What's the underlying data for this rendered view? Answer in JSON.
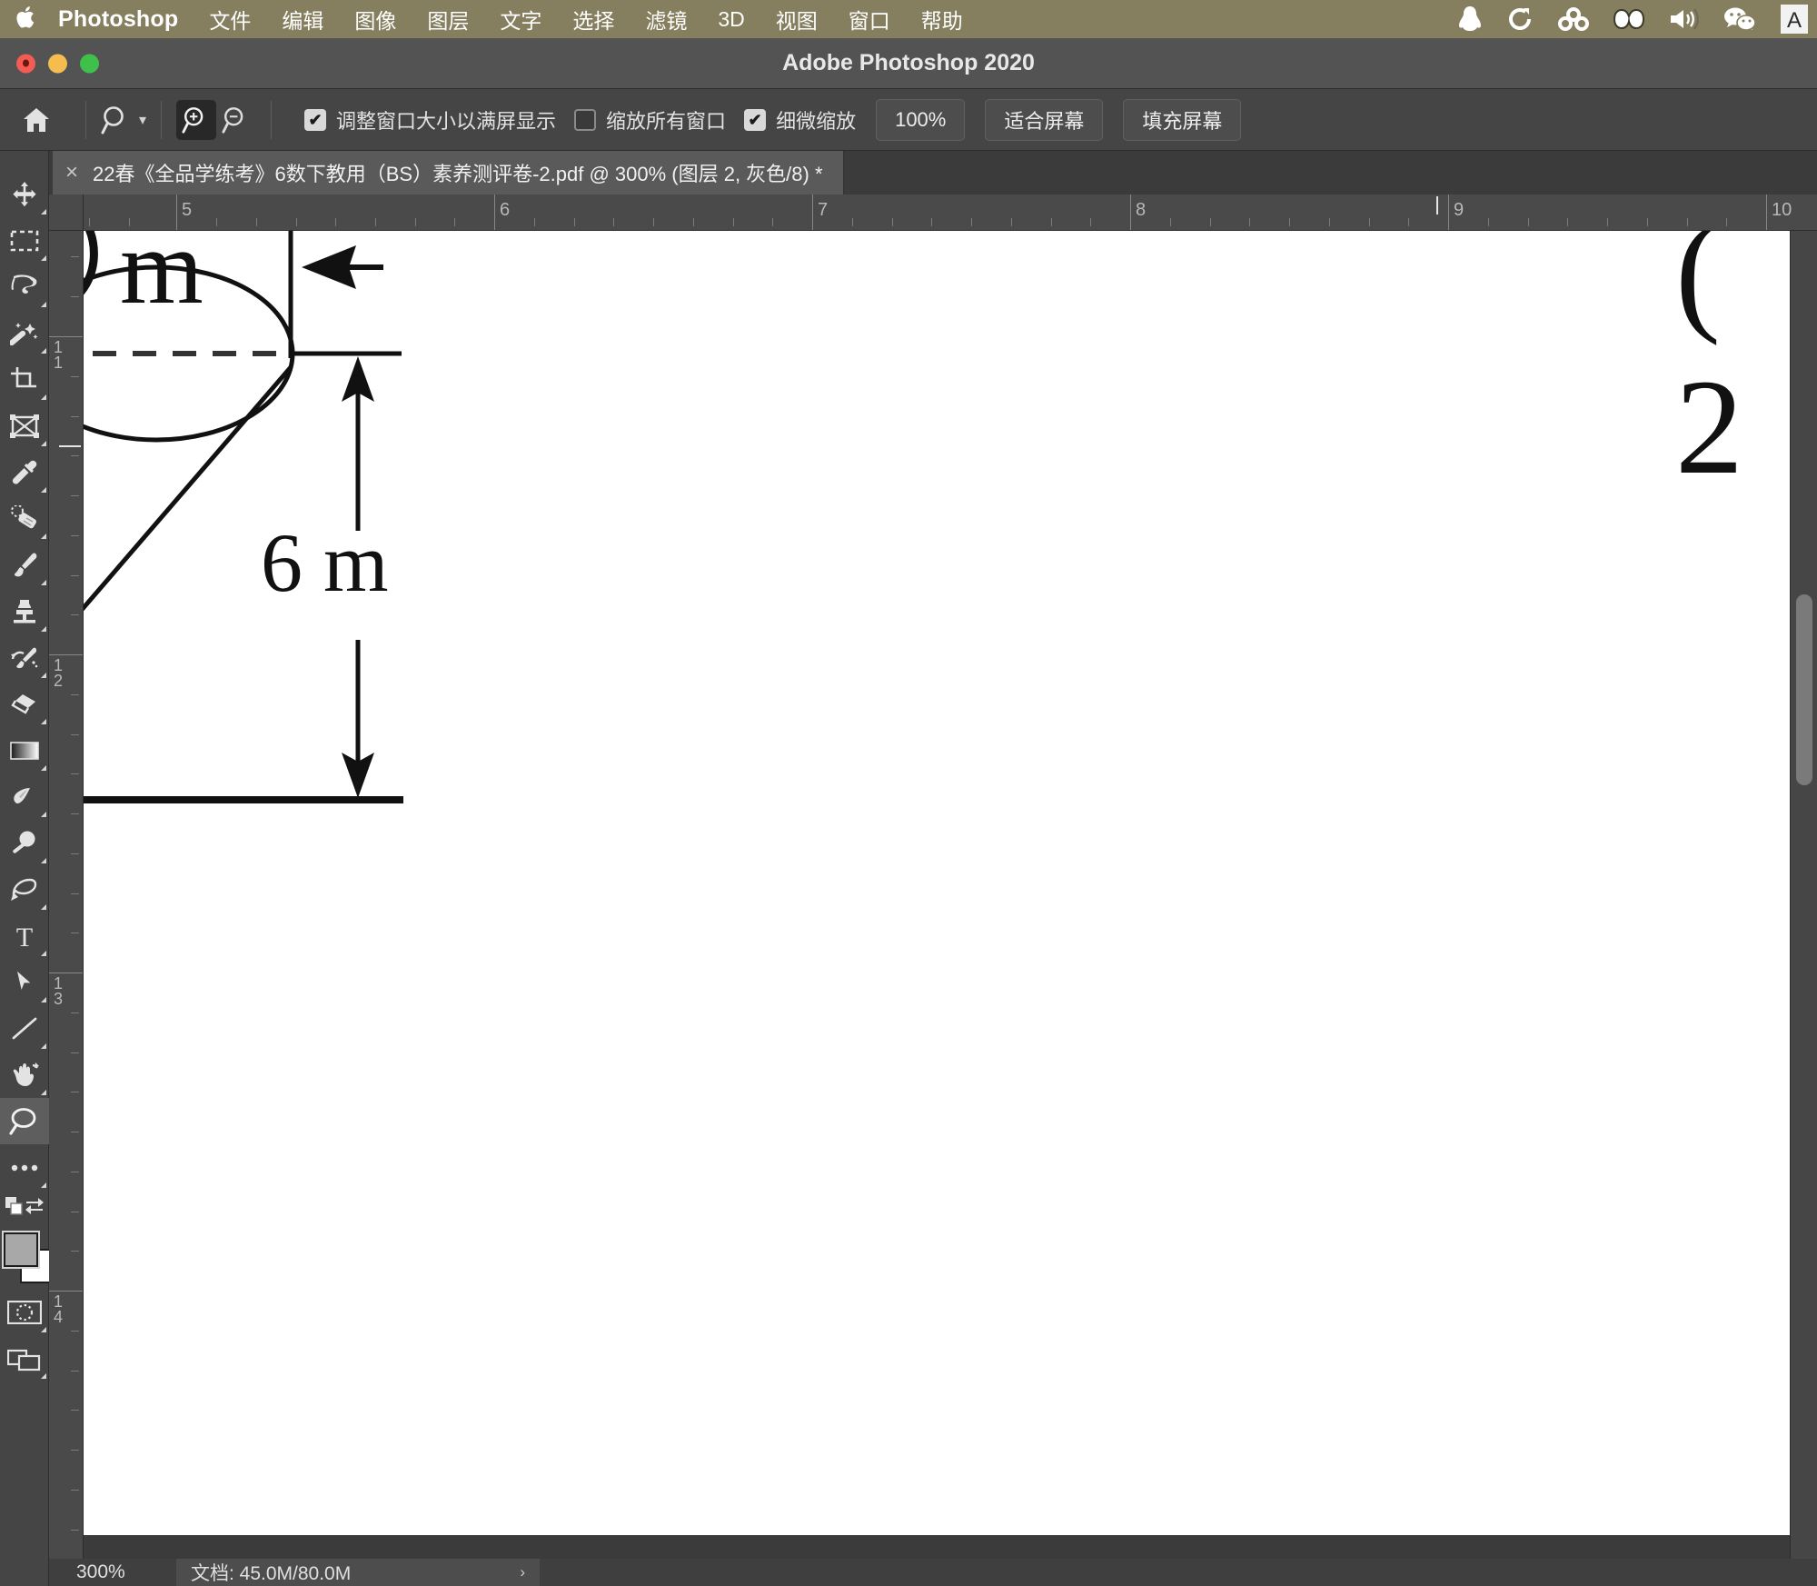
{
  "macos_menubar": {
    "apple_icon": "apple-logo-icon",
    "app_name": "Photoshop",
    "menus": [
      "文件",
      "编辑",
      "图像",
      "图层",
      "文字",
      "选择",
      "滤镜",
      "3D",
      "视图",
      "窗口",
      "帮助"
    ],
    "tray_icons": [
      "qq-penguin-icon",
      "sync-circle-icon",
      "creative-cloud-rings-icon",
      "adobe-cc-icon",
      "volume-speaker-icon",
      "wechat-icon",
      "input-method-a-icon"
    ],
    "background_color": "#857e5f"
  },
  "window": {
    "title": "Adobe Photoshop 2020",
    "traffic_lights": [
      "close-button",
      "minimize-button",
      "maximize-button"
    ]
  },
  "options_bar": {
    "home_icon": "home-icon",
    "tool_icon": "zoom-tool-icon",
    "tool_dropdown_icon": "chevron-down-icon",
    "zoom_in_icon": "zoom-in-icon",
    "zoom_out_icon": "zoom-out-icon",
    "checkboxes": [
      {
        "label": "调整窗口大小以满屏显示",
        "checked": true
      },
      {
        "label": "缩放所有窗口",
        "checked": false
      },
      {
        "label": "细微缩放",
        "checked": true
      }
    ],
    "buttons": [
      "100%",
      "适合屏幕",
      "填充屏幕"
    ]
  },
  "document_tab": {
    "close_icon": "close-icon",
    "title": "22春《全品学练考》6数下教用（BS）素养测评卷-2.pdf @ 300% (图层 2, 灰色/8) *"
  },
  "toolbar": {
    "tools": [
      {
        "name": "move-tool",
        "icon": "move-icon"
      },
      {
        "name": "marquee-tool",
        "icon": "rectangular-marquee-icon"
      },
      {
        "name": "lasso-tool",
        "icon": "lasso-icon"
      },
      {
        "name": "magic-wand-tool",
        "icon": "magic-wand-icon"
      },
      {
        "name": "crop-tool",
        "icon": "crop-icon"
      },
      {
        "name": "frame-tool",
        "icon": "frame-icon"
      },
      {
        "name": "eyedropper-tool",
        "icon": "eyedropper-icon"
      },
      {
        "name": "healing-brush-tool",
        "icon": "healing-brush-icon"
      },
      {
        "name": "brush-tool",
        "icon": "paintbrush-icon"
      },
      {
        "name": "clone-stamp-tool",
        "icon": "clone-stamp-icon"
      },
      {
        "name": "history-brush-tool",
        "icon": "history-brush-icon"
      },
      {
        "name": "eraser-tool",
        "icon": "eraser-icon"
      },
      {
        "name": "gradient-tool",
        "icon": "gradient-icon"
      },
      {
        "name": "blur-tool",
        "icon": "blur-drop-icon"
      },
      {
        "name": "dodge-tool",
        "icon": "dodge-icon"
      },
      {
        "name": "pen-tool",
        "icon": "pen-icon"
      },
      {
        "name": "type-tool",
        "icon": "type-T-icon"
      },
      {
        "name": "path-selection-tool",
        "icon": "path-arrow-icon"
      },
      {
        "name": "line-tool",
        "icon": "line-icon"
      },
      {
        "name": "hand-tool",
        "icon": "hand-icon"
      },
      {
        "name": "zoom-tool",
        "icon": "magnifier-icon",
        "selected": true
      },
      {
        "name": "more-tools",
        "icon": "ellipsis-icon"
      }
    ],
    "foreground_color": "#a8a8a8",
    "background_color": "#ffffff",
    "quick_mask_icon": "quick-mask-icon",
    "screen_mode_icon": "screen-mode-icon",
    "swap_colors_icon": "swap-colors-icon",
    "default_colors_icon": "default-colors-icon"
  },
  "rulers": {
    "unit_hint": "inches",
    "horizontal_labels": [
      "5",
      "6",
      "7",
      "8",
      "9",
      "10"
    ],
    "vertical_labels": [
      "11",
      "12",
      "13",
      "14"
    ],
    "cursor_x_position": "9"
  },
  "canvas": {
    "page_content_description": "cone geometry diagram",
    "texts": [
      {
        "name": "partial-top-label",
        "value": "m"
      },
      {
        "name": "height-dimension-label",
        "value": "6 m"
      },
      {
        "name": "problem-number",
        "value": "( 2"
      }
    ]
  },
  "status_bar": {
    "zoom_level": "300%",
    "doc_info": "文档: 45.0M/80.0M",
    "expand_icon": "chevron-right-icon"
  },
  "scrollbars": {
    "vertical": "vertical-scrollbar",
    "horizontal": "horizontal-scrollbar"
  }
}
